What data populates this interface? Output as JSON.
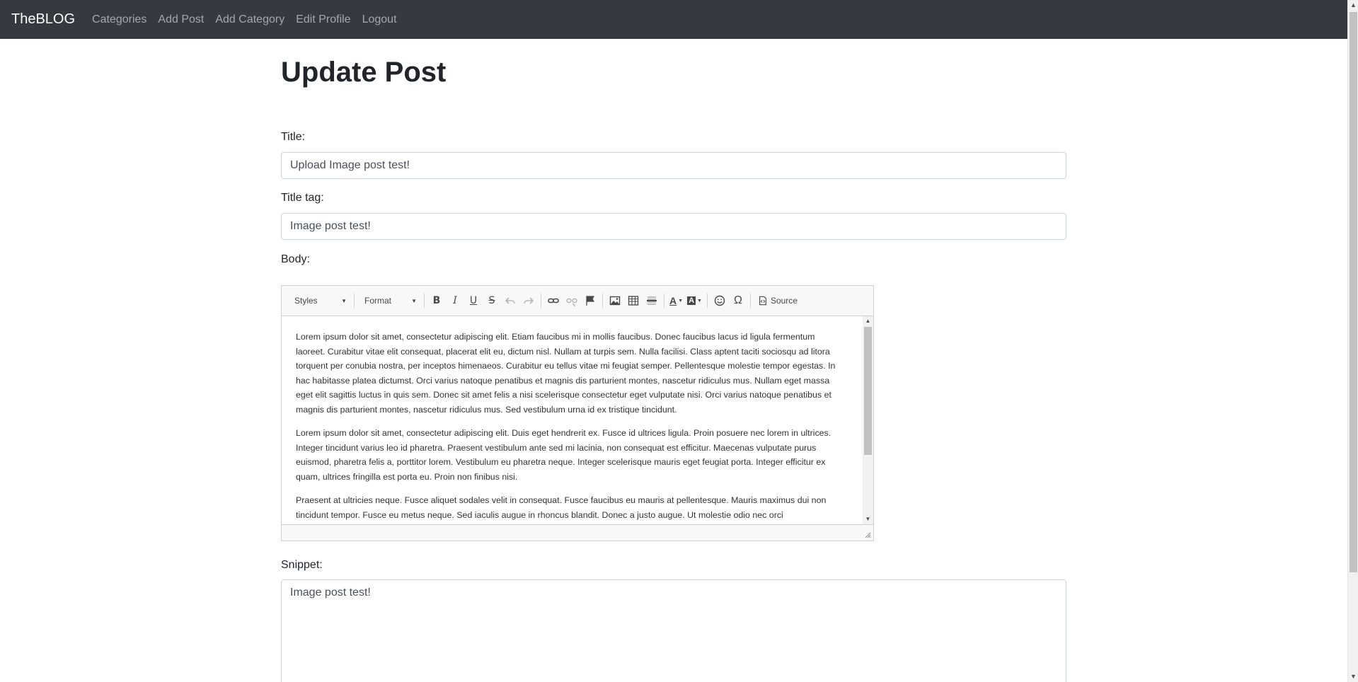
{
  "navbar": {
    "brand": "TheBLOG",
    "links": [
      "Categories",
      "Add Post",
      "Add Category",
      "Edit Profile",
      "Logout"
    ]
  },
  "page": {
    "title": "Update Post"
  },
  "form": {
    "title_label": "Title:",
    "title_value": "Upload Image post test!",
    "title_tag_label": "Title tag:",
    "title_tag_value": "Image post test!",
    "body_label": "Body:",
    "snippet_label": "Snippet:",
    "snippet_value": "Image post test!"
  },
  "editor": {
    "styles_label": "Styles",
    "format_label": "Format",
    "source_label": "Source",
    "paragraphs": [
      "Lorem ipsum dolor sit amet, consectetur adipiscing elit. Etiam faucibus mi in mollis faucibus. Donec faucibus lacus id ligula fermentum laoreet. Curabitur vitae elit consequat, placerat elit eu, dictum nisl. Nullam at turpis sem. Nulla facilisi. Class aptent taciti sociosqu ad litora torquent per conubia nostra, per inceptos himenaeos. Curabitur eu tellus vitae mi feugiat semper. Pellentesque molestie tempor egestas. In hac habitasse platea dictumst. Orci varius natoque penatibus et magnis dis parturient montes, nascetur ridiculus mus. Nullam eget massa eget elit sagittis luctus in quis sem. Donec sit amet felis a nisi scelerisque consectetur eget vulputate nisi. Orci varius natoque penatibus et magnis dis parturient montes, nascetur ridiculus mus. Sed vestibulum urna id ex tristique tincidunt.",
      "Lorem ipsum dolor sit amet, consectetur adipiscing elit. Duis eget hendrerit ex. Fusce id ultrices ligula. Proin posuere nec lorem in ultrices. Integer tincidunt varius leo id pharetra. Praesent vestibulum ante sed mi lacinia, non consequat est efficitur. Maecenas vulputate purus euismod, pharetra felis a, porttitor lorem. Vestibulum eu pharetra neque. Integer scelerisque mauris eget feugiat porta. Integer efficitur ex quam, ultrices fringilla est porta eu. Proin non finibus nisi.",
      "Praesent at ultricies neque. Fusce aliquet sodales velit in consequat. Fusce faucibus eu mauris at pellentesque. Mauris maximus dui non tincidunt tempor. Fusce eu metus neque. Sed iaculis augue in rhoncus blandit. Donec a justo augue. Ut molestie odio nec orci"
    ]
  }
}
